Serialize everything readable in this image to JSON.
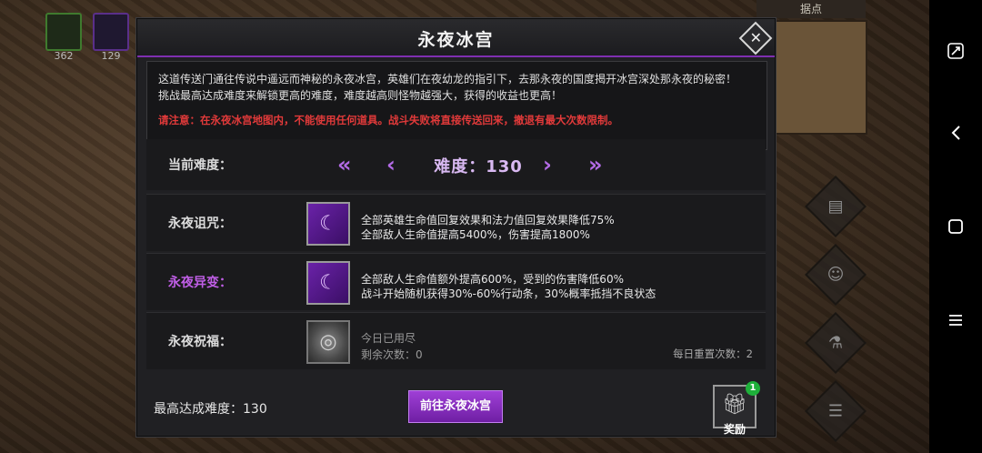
{
  "hud": {
    "hero_counts": [
      "362",
      "129"
    ],
    "minimap_title": "据点"
  },
  "dialog": {
    "title": "永夜冰宫",
    "description_line1": "这道传送门通往传说中遥远而神秘的永夜冰宫，英雄们在夜幼龙的指引下，去那永夜的国度揭开冰宫深处那永夜的秘密！",
    "description_line2": "挑战最高达成难度来解锁更高的难度，难度越高则怪物越强大，获得的收益也更高！",
    "warning": "请注意：在永夜冰宫地图内，不能使用任何道具。战斗失败将直接传送回来，撤退有最大次数限制。",
    "difficulty": {
      "label": "当前难度：",
      "value_text": "难度：130",
      "arrow_first": "«",
      "arrow_prev": "‹",
      "arrow_next": "›",
      "arrow_last": "»"
    },
    "curse": {
      "label": "永夜诅咒：",
      "line1": "全部英雄生命值回复效果和法力值回复效果降低75%",
      "line2": "全部敌人生命值提高5400%，伤害提高1800%"
    },
    "mutation": {
      "label": "永夜异变：",
      "line1": "全部敌人生命值额外提高600%，受到的伤害降低60%",
      "line2": "战斗开始随机获得30%-60%行动条，30%概率抵挡不良状态"
    },
    "blessing": {
      "label": "永夜祝福：",
      "line1": "今日已用尽",
      "line2": "剩余次数：0",
      "daily_reset": "每日重置次数：2"
    },
    "best_difficulty": "最高达成难度：130",
    "go_button": "前往永夜冰宫",
    "reward_label": "奖励",
    "reward_badge": "1",
    "close_symbol": "✕"
  },
  "colors": {
    "accent": "#7f2fb0",
    "warning": "#e23a3a",
    "mutation_label": "#c05ee6",
    "badge": "#1eb03a"
  }
}
